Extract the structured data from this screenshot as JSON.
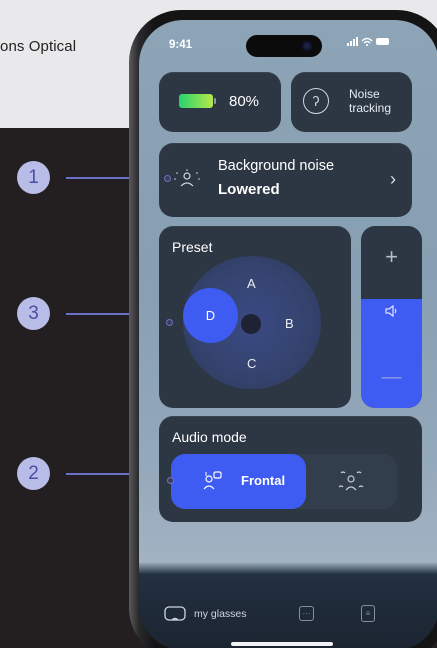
{
  "background": {
    "brand_text": "ons Optical"
  },
  "callouts": [
    {
      "number": "1"
    },
    {
      "number": "3"
    },
    {
      "number": "2"
    }
  ],
  "status_bar": {
    "time": "9:41",
    "icons": "..ıl ᯤ ▬"
  },
  "battery": {
    "percent_label": "80%",
    "level": 0.8,
    "colors": [
      "#27d36d",
      "#b6e84a"
    ]
  },
  "noise_tracking": {
    "label_line1": "Noise",
    "label_line2": "tracking",
    "icon": "ear-icon"
  },
  "background_noise": {
    "title": "Background noise",
    "value": "Lowered",
    "chevron": "›"
  },
  "preset": {
    "label": "Preset",
    "options": {
      "a": "A",
      "b": "B",
      "c": "C",
      "d": "D"
    },
    "selected": "D"
  },
  "volume": {
    "plus": "+",
    "minus": "—",
    "level": 0.6,
    "accent": "#3f5cf2"
  },
  "audio_mode": {
    "label": "Audio mode",
    "modes": [
      {
        "label": "Frontal",
        "icon": "frontal-listening-icon",
        "selected": true
      },
      {
        "label": "",
        "icon": "surround-listening-icon",
        "selected": false
      }
    ]
  },
  "tabbar": {
    "active_label": "my glasses"
  }
}
